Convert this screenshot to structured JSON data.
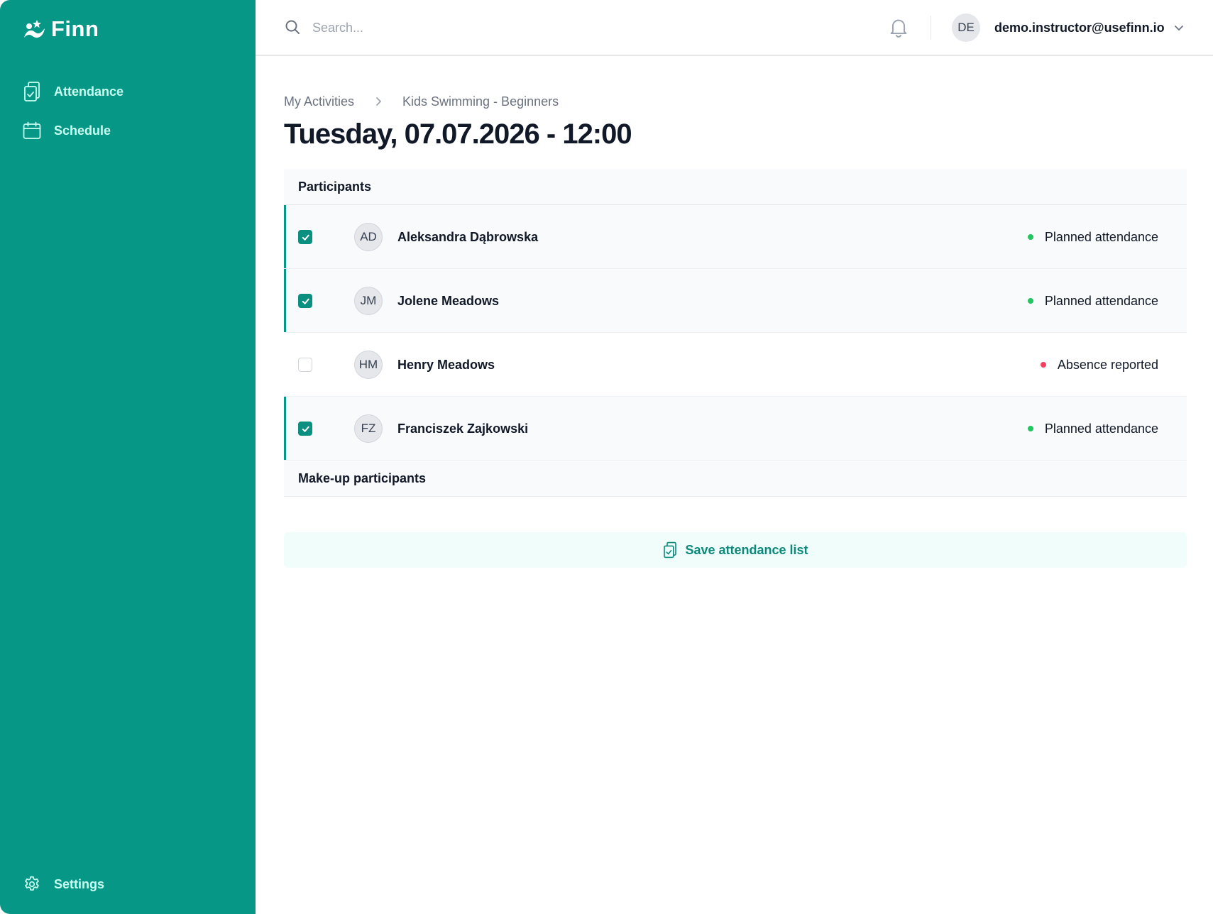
{
  "app": {
    "name": "Finn"
  },
  "sidebar": {
    "items": [
      {
        "label": "Attendance",
        "icon": "clipboard-check-icon"
      },
      {
        "label": "Schedule",
        "icon": "calendar-icon"
      }
    ],
    "settings": {
      "label": "Settings",
      "icon": "gear-icon"
    }
  },
  "topbar": {
    "search": {
      "placeholder": "Search...",
      "value": ""
    },
    "user": {
      "initials": "DE",
      "email": "demo.instructor@usefinn.io"
    }
  },
  "breadcrumb": [
    "My Activities",
    "Kids Swimming - Beginners"
  ],
  "page_title": "Tuesday, 07.07.2026 - 12:00",
  "sections": {
    "participants": "Participants",
    "makeup": "Make-up participants"
  },
  "participants": [
    {
      "initials": "AD",
      "name": "Aleksandra Dąbrowska",
      "checked": true,
      "status": "Planned attendance",
      "status_color": "#22c55e"
    },
    {
      "initials": "JM",
      "name": "Jolene Meadows",
      "checked": true,
      "status": "Planned attendance",
      "status_color": "#22c55e"
    },
    {
      "initials": "HM",
      "name": "Henry Meadows",
      "checked": false,
      "status": "Absence reported",
      "status_color": "#f43f5e"
    },
    {
      "initials": "FZ",
      "name": "Franciszek Zajkowski",
      "checked": true,
      "status": "Planned attendance",
      "status_color": "#22c55e"
    }
  ],
  "save_button": {
    "label": "Save attendance list"
  },
  "colors": {
    "brand": "#079787",
    "nav_text": "#c8fff1",
    "save_bg": "#f0fdfa",
    "save_text": "#0b8a7c"
  }
}
